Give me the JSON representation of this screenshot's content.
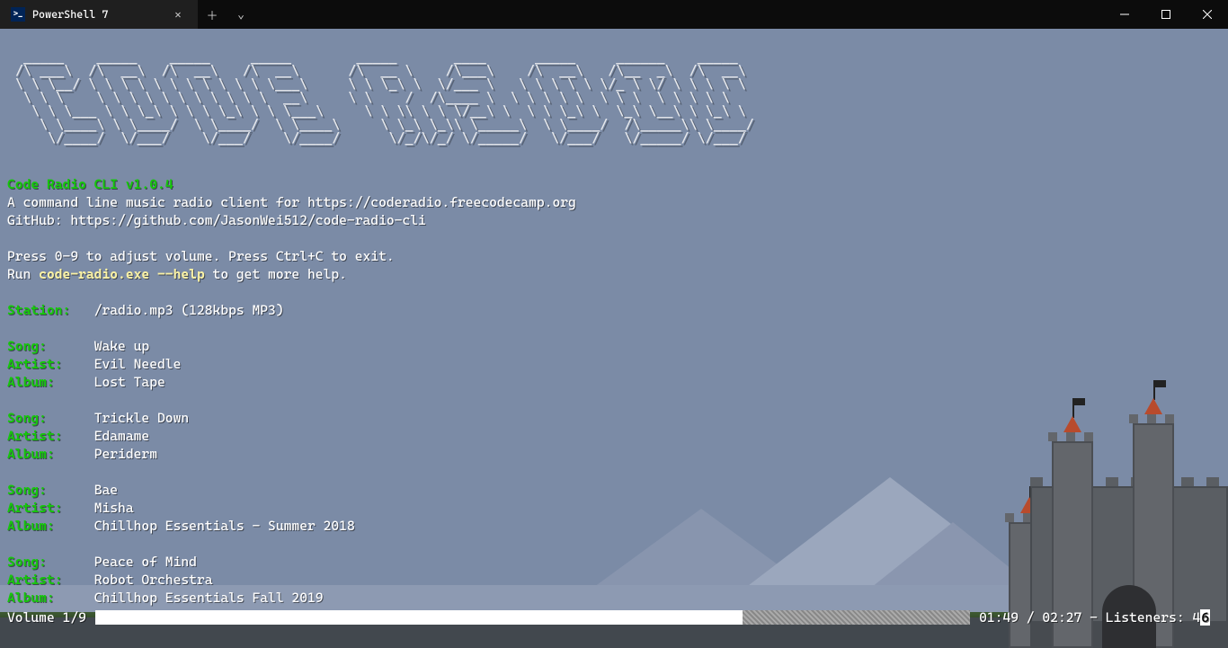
{
  "window": {
    "tab_title": "PowerShell 7"
  },
  "banner": "  _____    _____    _____     _____        _____       ____      _____     ______    _____  \n /\\ ___\\  /\\  __\\  /\\  __\\   /\\  __\\      /\\  __ \\    /\\___\\    /\\  __\\   /\\__  _\\  /\\  __\\ \n \\ \\ \\__/ \\ \\ \\ \\ \\ \\ \\ \\ \\ \\ \\ \\___\\     \\ \\ \\_\\ \\  \\/___ \\   \\ \\ \\ \\ \\ \\/_ \\ \\/ \\ \\ \\ \\ \\\n  \\ \\ \\    \\ \\ \\ \\ \\ \\ \\ \\ \\ \\ \\  __\\     \\ \\    /  /\\____ \\  \\ \\ \\ \\ \\  \\ \\ \\  \\ \\ \\ \\ \\\n   \\ \\ \\___ \\ \\ \\_\\ \\ \\ \\ \\_\\ \\ \\ \\___\\     \\ \\ \\\\ \\ \\ \\/__\\ \\  \\ \\ \\_\\ \\  \\_\\ \\__\\ \\ \\_\\ \\\n    \\ \\____\\ \\ \\____/  \\ \\____/  \\ \\____\\     \\ \\_\\ \\_\\\\ \\_____\\  \\ \\____/  /\\_____\\\\ \\____/\n     \\/____/  \\/___/    \\/___/    \\/____/      \\/_/\\/_/ \\/_____/   \\/___/   \\/_____/ \\/___/ ",
  "header": {
    "title": "Code Radio CLI v1.0.4",
    "desc": "A command line music radio client for https://coderadio.freecodecamp.org",
    "github_label": "GitHub: ",
    "github_url": "https://github.com/JasonWei512/code-radio-cli",
    "hint1": "Press 0-9 to adjust volume. Press Ctrl+C to exit.",
    "hint2_pre": "Run ",
    "hint2_cmd": "code-radio.exe --help",
    "hint2_post": " to get more help."
  },
  "station": {
    "label": "Station:",
    "value": "/radio.mp3 (128kbps MP3)"
  },
  "labels": {
    "song": "Song:",
    "artist": "Artist:",
    "album": "Album:"
  },
  "tracks": [
    {
      "song": "Wake up",
      "artist": "Evil Needle",
      "album": "Lost Tape"
    },
    {
      "song": "Trickle Down",
      "artist": "Edamame",
      "album": "Periderm"
    },
    {
      "song": "Bae",
      "artist": "Misha",
      "album": "Chillhop Essentials - Summer 2018"
    },
    {
      "song": "Peace of Mind",
      "artist": "Robot Orchestra",
      "album": "Chillhop Essentials Fall 2019"
    }
  ],
  "status": {
    "volume_label": "Volume 1/9",
    "elapsed": "01:49",
    "total": "02:27",
    "listeners_label": "Listeners:",
    "listeners_prefix": "4",
    "listeners_last": "6",
    "progress_pct": 74
  }
}
